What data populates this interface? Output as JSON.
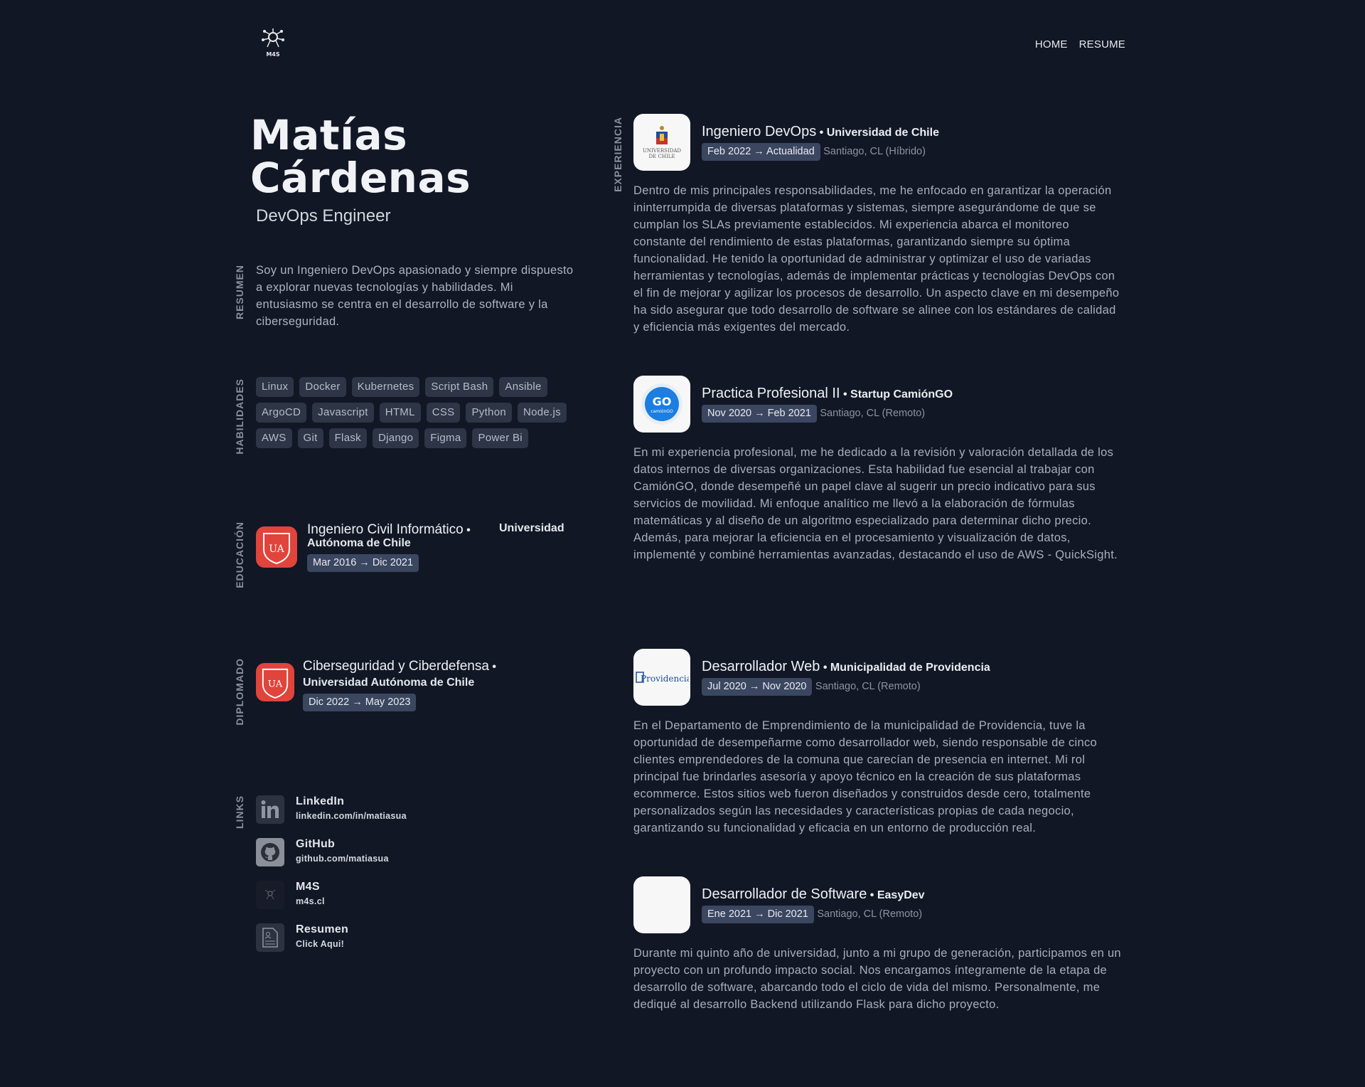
{
  "header": {
    "logo_text": "M4S",
    "nav": [
      "HOME",
      "RESUME"
    ]
  },
  "profile": {
    "first_name": "Matías",
    "last_name": "Cárdenas",
    "role": "DevOps Engineer"
  },
  "sections": {
    "summary": "RESUMEN",
    "skills": "HABILIDADES",
    "education": "EDUCACIÓN",
    "diploma": "DIPLOMADO",
    "links": "LINKS",
    "experience": "EXPERIENCIA"
  },
  "summary_text": "Soy un Ingeniero DevOps apasionado y siempre dispuesto a explorar nuevas tecnologías y habilidades. Mi entusiasmo se centra en el desarrollo de software y la ciberseguridad.",
  "skills": [
    "Linux",
    "Docker",
    "Kubernetes",
    "Script Bash",
    "Ansible",
    "ArgoCD",
    "Javascript",
    "HTML",
    "CSS",
    "Python",
    "Node.js",
    "AWS",
    "Git",
    "Flask",
    "Django",
    "Figma",
    "Power Bi"
  ],
  "education": {
    "title": "Ingeniero Civil Informático",
    "org": "Universidad Autónoma de Chile",
    "dates": "Mar 2016 → Dic 2021",
    "logo_text": "UA"
  },
  "diploma": {
    "title": "Ciberseguridad y Ciberdefensa",
    "org": "Universidad Autónoma de Chile",
    "dates": "Dic 2022 → May 2023",
    "logo_text": "UA"
  },
  "links": [
    {
      "title": "LinkedIn",
      "sub": "linkedin.com/in/matiasua",
      "icon": "linkedin-icon"
    },
    {
      "title": "GitHub",
      "sub": "github.com/matiasua",
      "icon": "github-icon"
    },
    {
      "title": "M4S",
      "sub": "m4s.cl",
      "icon": "m4s-icon"
    },
    {
      "title": "Resumen",
      "sub": "Click Aqui!",
      "icon": "document-icon"
    }
  ],
  "experience": [
    {
      "title": "Ingeniero DevOps",
      "org": "Universidad de Chile",
      "dates": "Feb 2022 → Actualidad",
      "location": "Santiago, CL (Híbrido)",
      "logo_text": "UNIVERSIDAD DE CHILE",
      "desc": "Dentro de mis principales responsabilidades, me he enfocado en garantizar la operación ininterrumpida de diversas plataformas y sistemas, siempre asegurándome de que se cumplan los SLAs previamente establecidos. Mi experiencia abarca el monitoreo constante del rendimiento de estas plataformas, garantizando siempre su óptima funcionalidad. He tenido la oportunidad de administrar y optimizar el uso de variadas herramientas y tecnologías, además de implementar prácticas y tecnologías DevOps con el fin de mejorar y agilizar los procesos de desarrollo. Un aspecto clave en mi desempeño ha sido asegurar que todo desarrollo de software se alinee con los estándares de calidad y eficiencia más exigentes del mercado."
    },
    {
      "title": "Practica Profesional II",
      "org": "Startup CamiónGO",
      "dates": "Nov 2020 → Feb 2021",
      "location": "Santiago, CL (Remoto)",
      "logo_text": "camiónGO",
      "desc": "En mi experiencia profesional, me he dedicado a la revisión y valoración detallada de los datos internos de diversas organizaciones. Esta habilidad fue esencial al trabajar con CamiónGO, donde desempeñé un papel clave al sugerir un precio indicativo para sus servicios de movilidad. Mi enfoque analítico me llevó a la elaboración de fórmulas matemáticas y al diseño de un algoritmo especializado para determinar dicho precio. Además, para mejorar la eficiencia en el procesamiento y visualización de datos, implementé y combiné herramientas avanzadas, destacando el uso de AWS - QuickSight."
    },
    {
      "title": "Desarrollador Web",
      "org": "Municipalidad de Providencia",
      "dates": "Jul 2020 → Nov 2020",
      "location": "Santiago, CL (Remoto)",
      "logo_text": "Providencia",
      "desc": "En el Departamento de Emprendimiento de la municipalidad de Providencia, tuve la oportunidad de desempeñarme como desarrollador web, siendo responsable de cinco clientes emprendedores de la comuna que carecían de presencia en internet. Mi rol principal fue brindarles asesoría y apoyo técnico en la creación de sus plataformas ecommerce. Estos sitios web fueron diseñados y construidos desde cero, totalmente personalizados según las necesidades y características propias de cada negocio, garantizando su funcionalidad y eficacia en un entorno de producción real."
    },
    {
      "title": "Desarrollador de Software",
      "org": "EasyDev",
      "dates": "Ene 2021 → Dic 2021",
      "location": "Santiago, CL (Remoto)",
      "logo_text": "",
      "desc": "Durante mi quinto año de universidad, junto a mi grupo de generación, participamos en un proyecto con un profundo impacto social. Nos encargamos íntegramente de la etapa de desarrollo de software, abarcando todo el ciclo de vida del mismo. Personalmente, me dediqué al desarrollo Backend utilizando Flask para dicho proyecto."
    }
  ]
}
